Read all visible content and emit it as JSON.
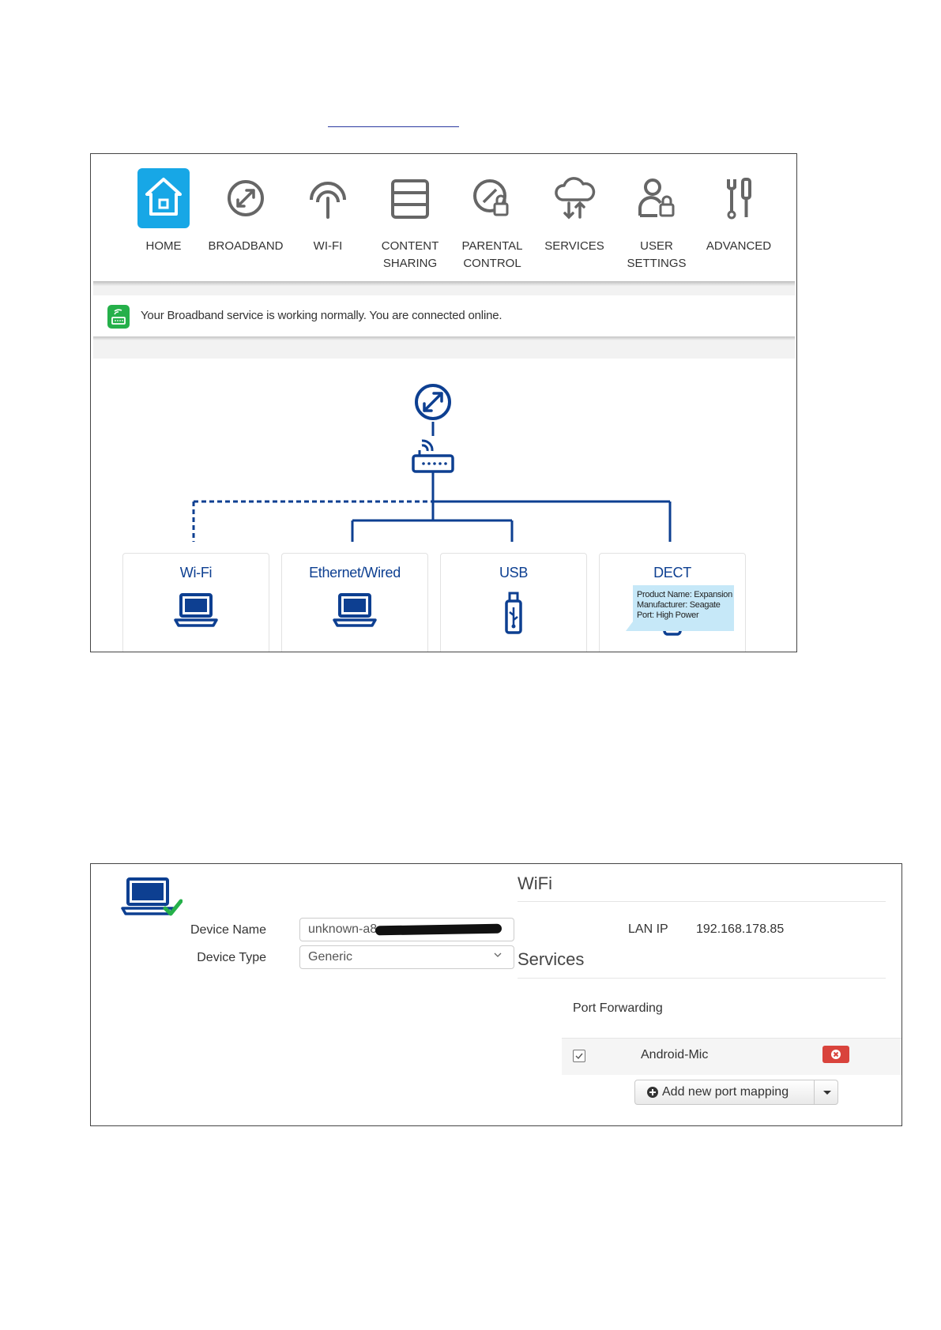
{
  "nav": {
    "items": [
      {
        "label": "HOME",
        "icon": "home-icon",
        "active": true
      },
      {
        "label": "BROADBAND",
        "icon": "broadband-icon"
      },
      {
        "label": "WI-FI",
        "icon": "wifi-icon"
      },
      {
        "label": "CONTENT\nSHARING",
        "icon": "content-sharing-icon"
      },
      {
        "label": "PARENTAL\nCONTROL",
        "icon": "parental-control-icon"
      },
      {
        "label": "SERVICES",
        "icon": "services-icon"
      },
      {
        "label": "USER\nSETTINGS",
        "icon": "user-settings-icon"
      },
      {
        "label": "ADVANCED",
        "icon": "advanced-icon"
      }
    ]
  },
  "status": {
    "text": "Your Broadband service is working normally. You are connected online."
  },
  "topology": {
    "cards": [
      {
        "title": "Wi-Fi",
        "icon": "laptop-icon"
      },
      {
        "title": "Ethernet/Wired",
        "icon": "laptop-icon"
      },
      {
        "title": "USB",
        "icon": "usb-stick-icon"
      },
      {
        "title": "DECT",
        "icon": "cordless-phone-icon"
      }
    ],
    "tooltip": {
      "line1": "Product Name: Expansion",
      "line2": "Manufacturer: Seagate",
      "line3": "Port: High Power"
    }
  },
  "colors": {
    "accent": "#17a7e6",
    "navy": "#0d3f91",
    "status_green": "#25b04a",
    "delete_red": "#d9433c"
  },
  "device": {
    "name_label": "Device Name",
    "name_value": "unknown-a8",
    "type_label": "Device Type",
    "type_value": "Generic",
    "wifi_title": "WiFi",
    "lan_label": "LAN IP",
    "lan_value": "192.168.178.85",
    "services_title": "Services",
    "port_forwarding_label": "Port Forwarding",
    "mapping_name": "Android-Mic",
    "add_mapping_label": "Add new port mapping"
  }
}
